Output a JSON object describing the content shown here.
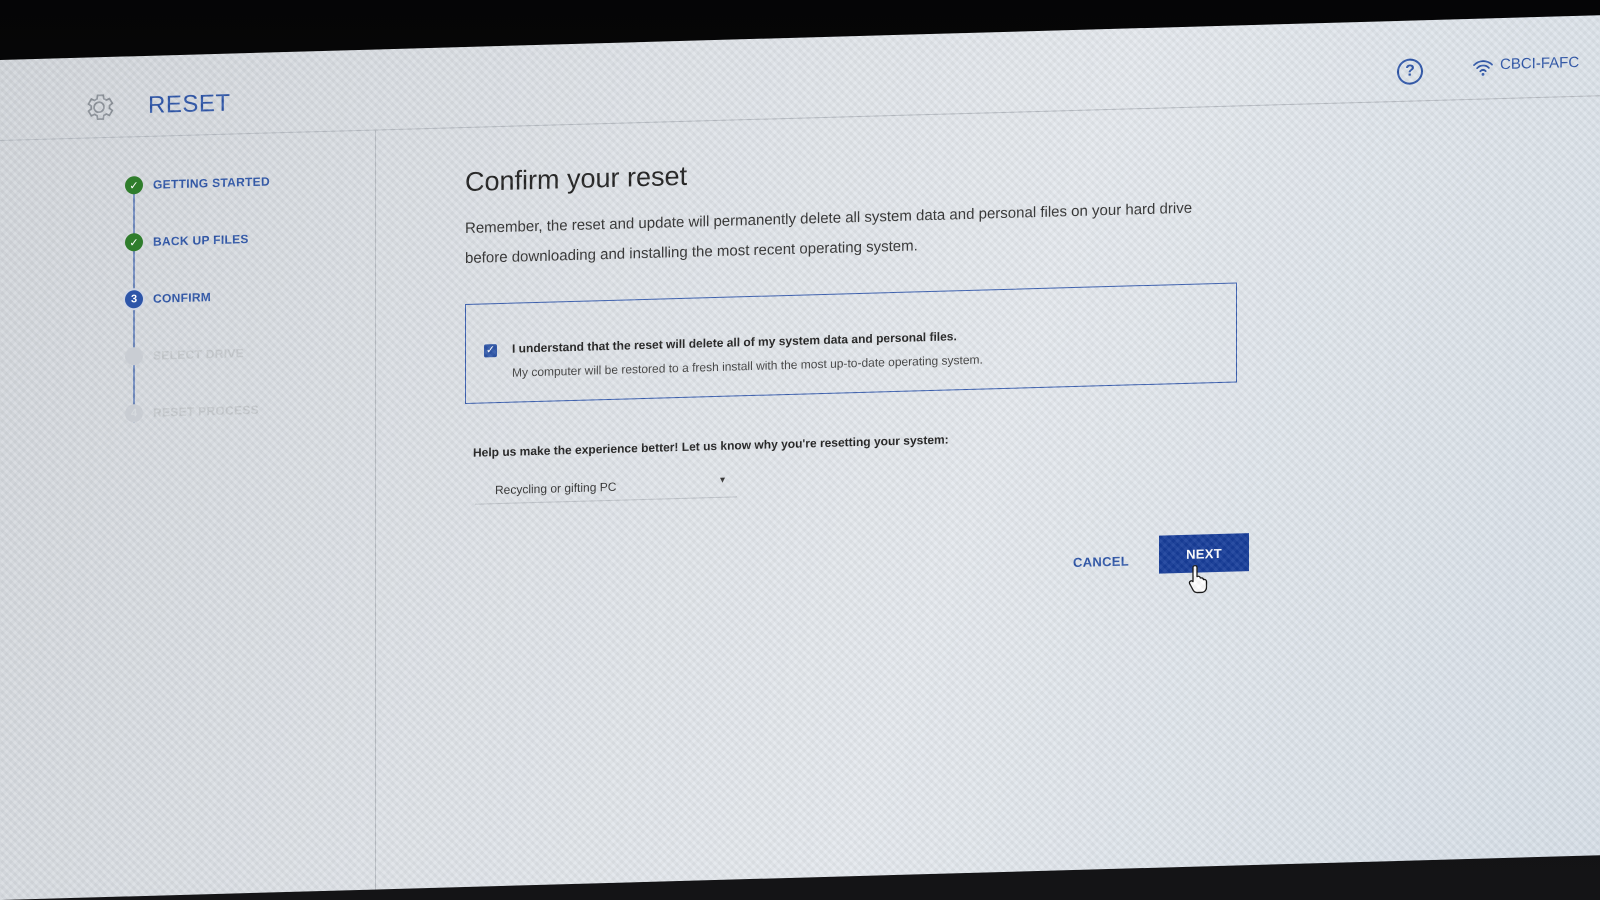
{
  "header": {
    "app_title": "RESET",
    "network_name": "CBCI-FAFC",
    "icons": {
      "settings": "gear-icon",
      "help": "help-circle-icon",
      "wifi": "wifi-icon"
    },
    "help_symbol": "?"
  },
  "sidebar": {
    "steps": [
      {
        "label": "GETTING STARTED",
        "state": "done",
        "marker": "✓"
      },
      {
        "label": "BACK UP FILES",
        "state": "done",
        "marker": "✓"
      },
      {
        "label": "CONFIRM",
        "state": "current",
        "marker": "3"
      },
      {
        "label": "SELECT DRIVE",
        "state": "pending",
        "marker": ""
      },
      {
        "label": "RESET PROCESS",
        "state": "pending",
        "marker": "4"
      }
    ]
  },
  "main": {
    "title": "Confirm your reset",
    "description_line1": "Remember, the reset and update will permanently delete all system data and personal files on your hard drive",
    "description_line2": "before downloading and installing the most recent operating system.",
    "confirm": {
      "checked": true,
      "check_mark": "✓",
      "main_text": "I understand that the reset will delete all of my system data and personal files.",
      "sub_text": "My computer will be restored to a fresh install with the most up-to-date operating system."
    },
    "feedback_prompt": "Help us make the experience better! Let us know why you're resetting your system:",
    "reason_select": {
      "selected": "Recycling or gifting PC",
      "caret": "▾"
    }
  },
  "actions": {
    "cancel_label": "CANCEL",
    "next_label": "NEXT"
  },
  "colors": {
    "accent": "#2d55a8",
    "primary_button": "#173d9a",
    "done_green": "#2f7d2c",
    "pending_gray": "#c6cace"
  }
}
